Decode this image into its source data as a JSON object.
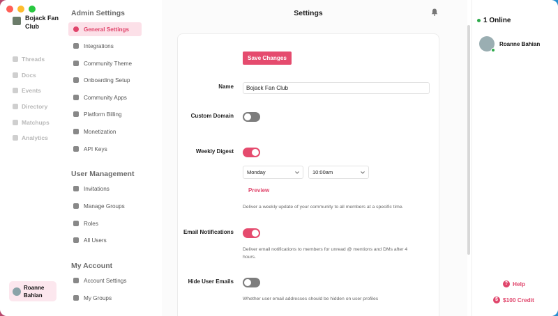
{
  "window": {
    "title": "Settings"
  },
  "brand": {
    "name": "Bojack Fan Club"
  },
  "nav": {
    "items": [
      {
        "label": "Threads",
        "icon": "threads-icon"
      },
      {
        "label": "Docs",
        "icon": "docs-icon"
      },
      {
        "label": "Events",
        "icon": "events-icon"
      },
      {
        "label": "Directory",
        "icon": "directory-icon"
      },
      {
        "label": "Matchups",
        "icon": "matchups-icon"
      },
      {
        "label": "Analytics",
        "icon": "analytics-icon"
      }
    ],
    "user_name": "Roanne Bahian"
  },
  "admin": {
    "admin_title": "Admin Settings",
    "admin_items": [
      {
        "label": "General Settings",
        "active": true
      },
      {
        "label": "Integrations"
      },
      {
        "label": "Community Theme"
      },
      {
        "label": "Onboarding Setup"
      },
      {
        "label": "Community Apps"
      },
      {
        "label": "Platform Billing"
      },
      {
        "label": "Monetization"
      },
      {
        "label": "API Keys"
      }
    ],
    "user_mgmt_title": "User Management",
    "user_mgmt_items": [
      {
        "label": "Invitations"
      },
      {
        "label": "Manage Groups"
      },
      {
        "label": "Roles"
      },
      {
        "label": "All Users"
      }
    ],
    "account_title": "My Account",
    "account_items": [
      {
        "label": "Account Settings"
      },
      {
        "label": "My Groups"
      }
    ]
  },
  "form": {
    "save_label": "Save Changes",
    "name_label": "Name",
    "name_value": "Bojack Fan Club",
    "custom_domain_label": "Custom Domain",
    "custom_domain_on": false,
    "weekly_digest_label": "Weekly Digest",
    "weekly_digest_on": true,
    "day_value": "Monday",
    "time_value": "10:00am",
    "preview_label": "Preview",
    "weekly_digest_help": "Deliver a weekly update of your community to all members at a specific time.",
    "email_notif_label": "Email Notifications",
    "email_notif_on": true,
    "email_notif_help": "Deliver email notifications to members for unread @ mentions and DMs after 4 hours.",
    "hide_emails_label": "Hide User Emails",
    "hide_emails_on": false,
    "hide_emails_help": "Whether user email addresses should be hidden on user profiles"
  },
  "right": {
    "online_label": "1 Online",
    "member_name": "Roanne Bahian",
    "help_label": "Help",
    "credit_label": "$100 Credit"
  },
  "colors": {
    "accent": "#e54b6e",
    "online": "#2eaa4b"
  }
}
